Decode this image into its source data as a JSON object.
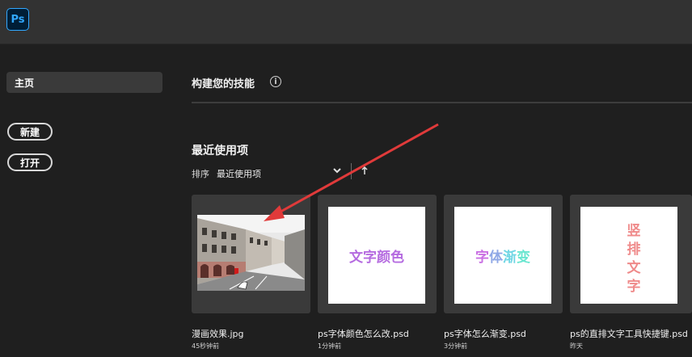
{
  "app": {
    "logo_text": "Ps"
  },
  "sidebar": {
    "home_label": "主页",
    "new_button": "新建",
    "open_button": "打开"
  },
  "main": {
    "section_title": "构建您的技能",
    "recent_title": "最近使用项",
    "sort_label": "排序",
    "sort_value": "最近使用项",
    "files": [
      {
        "name": "漫画效果.jpg",
        "time": "45秒钟前"
      },
      {
        "name": "ps字体颜色怎么改.psd",
        "time": "1分钟前",
        "thumb_text": "文字颜色"
      },
      {
        "name": "ps字体怎么渐变.psd",
        "time": "3分钟前",
        "thumb_text": [
          "字",
          "体",
          "渐",
          "变"
        ]
      },
      {
        "name": "ps的直排文字工具快捷键.psd",
        "time": "昨天",
        "thumb_text": [
          "竖",
          "排",
          "文",
          "字"
        ]
      }
    ]
  },
  "colors": {
    "thumb2_text": "#b56be0",
    "thumb3_colors": [
      "#c96fe3",
      "#8fa8e6",
      "#6fd6e4",
      "#6ae6d0"
    ],
    "thumb4_text": "#ef8a8a",
    "annotation_arrow": "#e03a3a"
  }
}
